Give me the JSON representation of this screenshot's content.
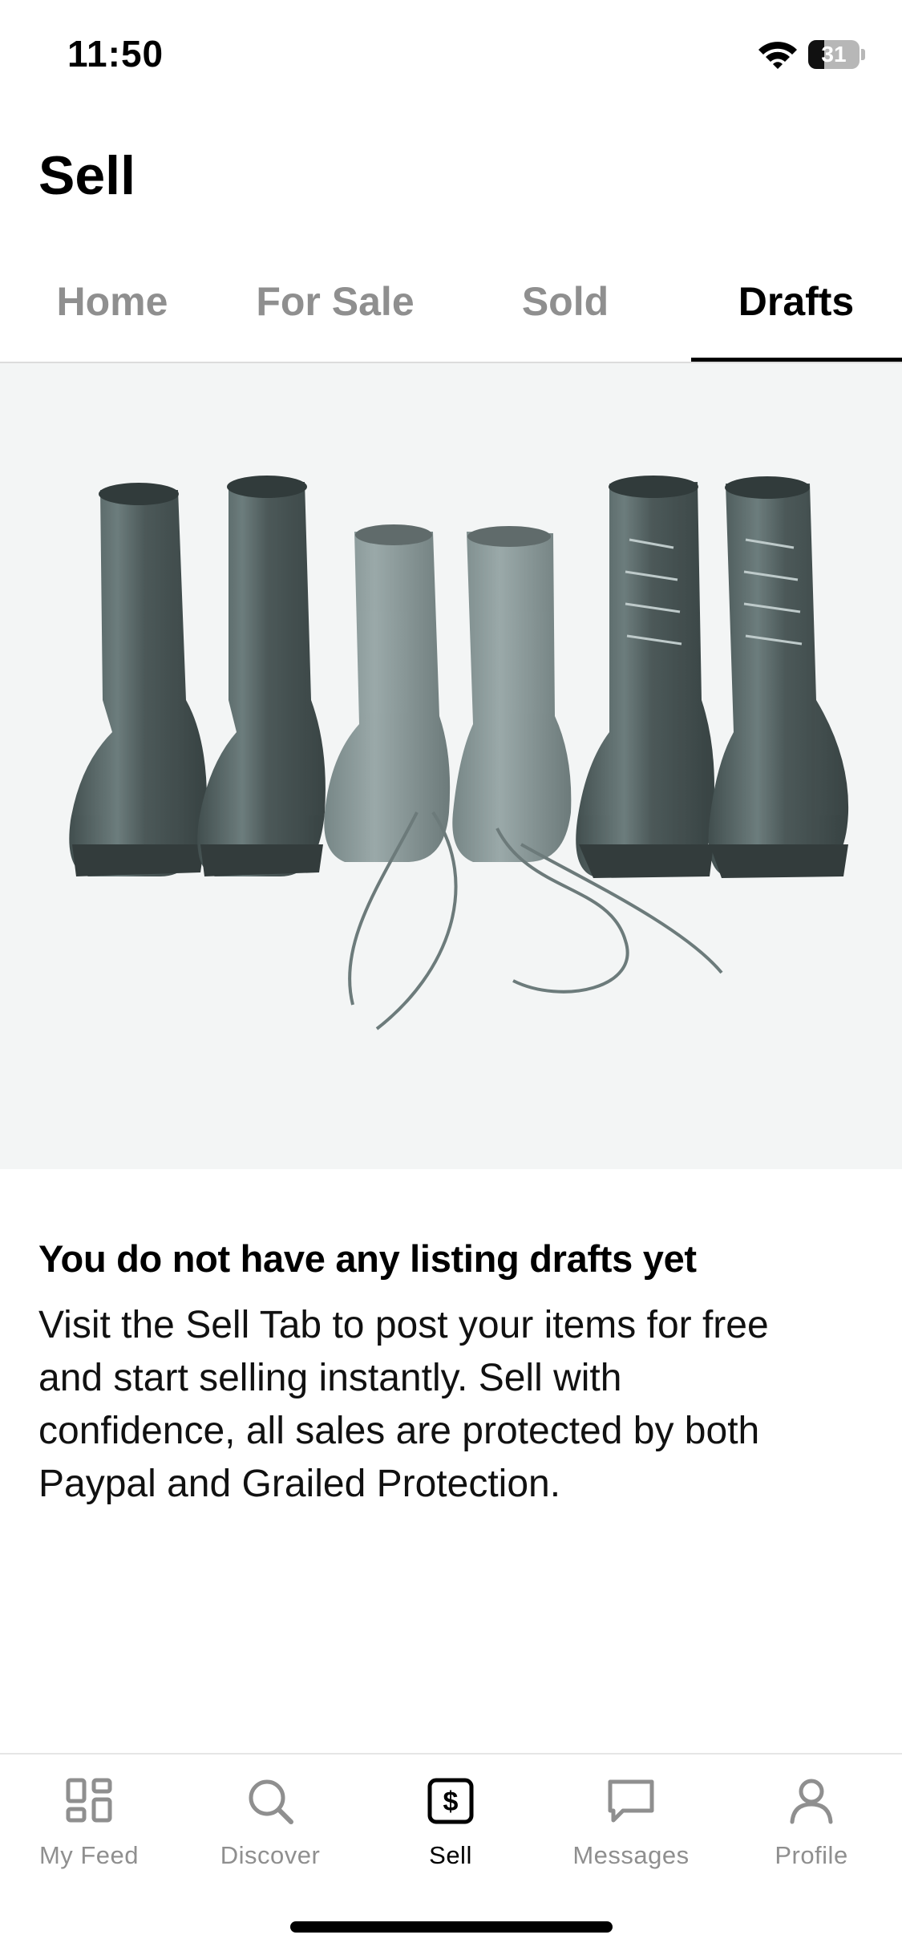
{
  "status_bar": {
    "time": "11:50",
    "battery_level": "31",
    "battery_fraction": 0.31,
    "icons": [
      "wifi-icon",
      "battery-icon"
    ]
  },
  "header": {
    "title": "Sell"
  },
  "tabs": [
    {
      "label": "Home",
      "active": false
    },
    {
      "label": "For Sale",
      "active": false
    },
    {
      "label": "Sold",
      "active": false
    },
    {
      "label": "Drafts",
      "active": true
    }
  ],
  "hero_image": {
    "subject": "three pairs of black leather boots with untied laces",
    "icon": "boots-illustration"
  },
  "empty_state": {
    "title": "You do not have any listing drafts yet",
    "lines": [
      "Visit the Sell Tab to post your items for free",
      "and start selling instantly. Sell with",
      "confidence, all sales are protected by both",
      "Paypal and Grailed Protection."
    ]
  },
  "tabbar": {
    "items": [
      {
        "label": "My Feed",
        "icon": "grid-icon",
        "active": false
      },
      {
        "label": "Discover",
        "icon": "search-icon",
        "active": false
      },
      {
        "label": "Sell",
        "icon": "dollar-tag-icon",
        "active": true
      },
      {
        "label": "Messages",
        "icon": "chat-bubble-icon",
        "active": false
      },
      {
        "label": "Profile",
        "icon": "person-icon",
        "active": false
      }
    ]
  },
  "colors": {
    "active_text": "#000000",
    "inactive_text": "#8f8f8f",
    "hero_background": "#f3f5f5",
    "divider": "#dcdcdc"
  }
}
